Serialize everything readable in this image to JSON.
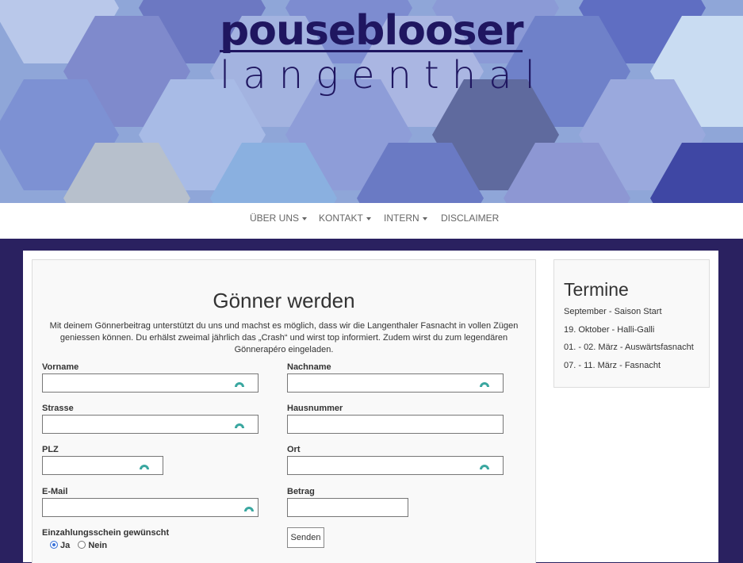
{
  "brand": {
    "line1": "pouseblooser",
    "line2": "langenthal"
  },
  "nav": {
    "items": [
      {
        "label": "Über uns",
        "dropdown": true
      },
      {
        "label": "Kontakt",
        "dropdown": true
      },
      {
        "label": "Intern",
        "dropdown": true
      },
      {
        "label": "Disclaimer",
        "dropdown": false
      }
    ]
  },
  "form": {
    "title": "Gönner werden",
    "intro": "Mit deinem Gönnerbeitrag unterstützt du uns und machst es möglich, dass wir die Langenthaler Fasnacht in vollen Zügen geniessen können. Du erhälst zweimal jährlich das „Crash“ und wirst top informiert. Zudem wirst du zum legendären Gönnerapéro eingeladen.",
    "fields": {
      "vorname": {
        "label": "Vorname",
        "value": ""
      },
      "nachname": {
        "label": "Nachname",
        "value": ""
      },
      "strasse": {
        "label": "Strasse",
        "value": ""
      },
      "hausnummer": {
        "label": "Hausnummer",
        "value": ""
      },
      "plz": {
        "label": "PLZ",
        "value": ""
      },
      "ort": {
        "label": "Ort",
        "value": ""
      },
      "email": {
        "label": "E-Mail",
        "value": ""
      },
      "betrag": {
        "label": "Betrag",
        "value": ""
      }
    },
    "einzahlung": {
      "label": "Einzahlungsschein gewünscht",
      "options": [
        "Ja",
        "Nein"
      ],
      "selected": "Ja"
    },
    "submit_label": "Senden"
  },
  "sidebar": {
    "title": "Termine",
    "items": [
      "September - Saison Start",
      "19. Oktober - Halli-Galli",
      "01. - 02. März - Auswärtsfasnacht",
      "07. - 11. März - Fasnacht"
    ]
  },
  "colors": {
    "page_background": "#2a2160",
    "brand": "#1f1660",
    "radio_selected": "#3b73d9",
    "autofill_icon": "#3aa7a0"
  }
}
